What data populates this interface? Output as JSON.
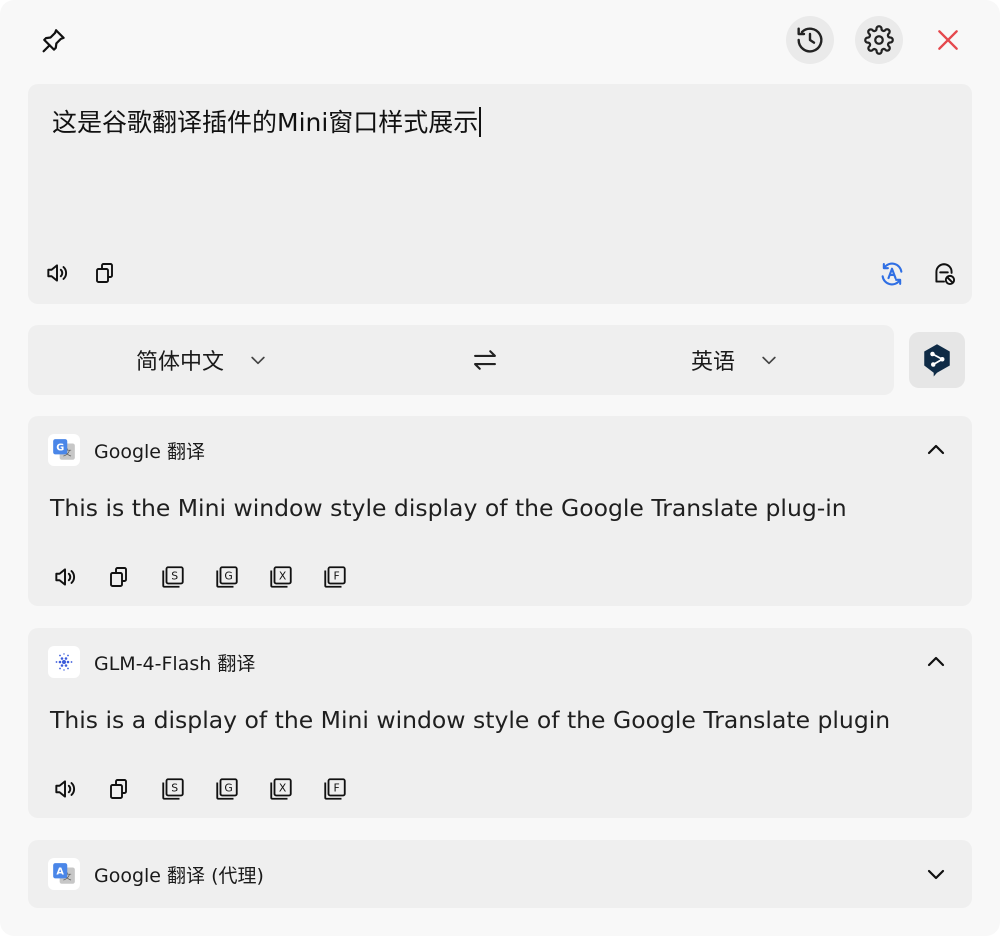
{
  "input": {
    "text": "这是谷歌翻译插件的Mini窗口样式展示"
  },
  "languages": {
    "source": "简体中文",
    "target": "英语"
  },
  "services": [
    {
      "name": "Google 翻译",
      "result": "This is the Mini window style display of the Google Translate plug-in",
      "expanded": true
    },
    {
      "name": "GLM-4-Flash 翻译",
      "result": "This is a display of the Mini window style of the Google Translate plugin",
      "expanded": true
    },
    {
      "name": "Google 翻译 (代理)",
      "expanded": false
    }
  ],
  "action_letters": [
    "S",
    "G",
    "X",
    "F"
  ],
  "colors": {
    "close": "#e5484d",
    "accent": "#2f6fe4",
    "deepl": "#0f2b46"
  }
}
